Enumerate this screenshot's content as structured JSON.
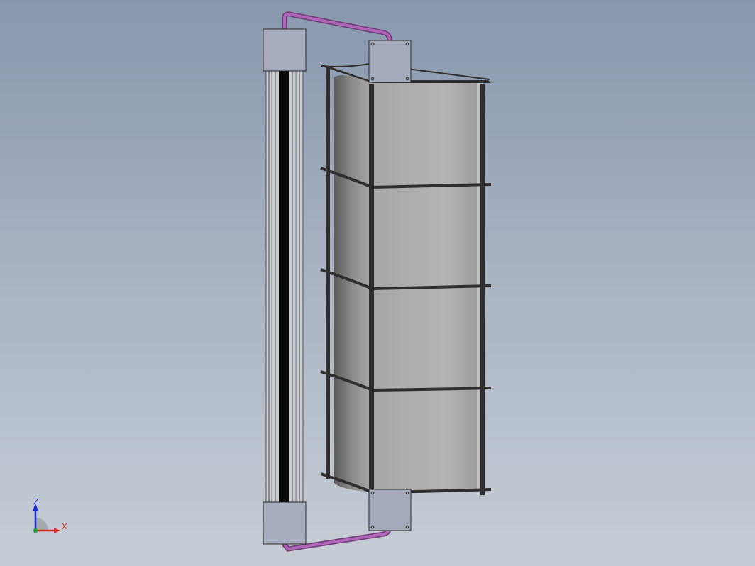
{
  "viewport": {
    "background_top": "#8797ad",
    "background_bottom": "#c7ccd4"
  },
  "model": {
    "components": [
      "vertical-slide-rail",
      "top-rail-block",
      "bottom-rail-block",
      "curved-panel-frame",
      "top-connector-pipe",
      "bottom-connector-pipe",
      "top-mount-plate",
      "bottom-mount-plate"
    ],
    "colors": {
      "pipe": "#a05aa8",
      "block": "#a4a9bc",
      "panel_light": "#b0b0b0",
      "panel_dark": "#6f6f6f",
      "frame": "#2e2e2e",
      "rail_track": "#000000"
    }
  },
  "triad": {
    "z_label": "Z",
    "x_label": "X",
    "z_color": "#1a2fd6",
    "x_color": "#d62a1a",
    "y_color": "#1aa02a"
  }
}
